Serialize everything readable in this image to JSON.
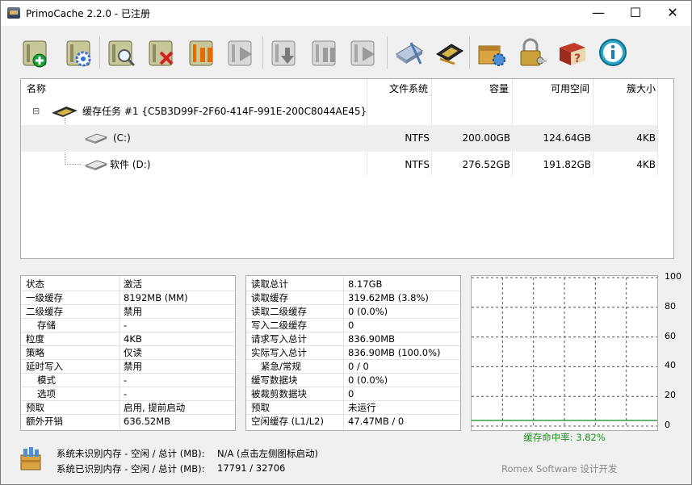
{
  "window": {
    "title": "PrimoCache 2.2.0 - 已注册",
    "controls": {
      "minimize": "—",
      "maximize": "☐",
      "close": "✕"
    }
  },
  "toolbar": {
    "buttons": [
      {
        "name": "new-cache-task",
        "icon": "disk-plus-icon"
      },
      {
        "name": "cache-properties",
        "icon": "disk-gear-icon"
      },
      {
        "name": "cache-statistics",
        "icon": "disk-magnifier-icon"
      },
      {
        "name": "delete-cache-task",
        "icon": "disk-x-icon"
      },
      {
        "name": "pause-cache",
        "icon": "disk-pause-icon"
      },
      {
        "name": "resume-cache",
        "icon": "disk-play-icon"
      },
      {
        "name": "flush-cache",
        "icon": "disk-download-icon"
      },
      {
        "name": "pause-all",
        "icon": "disk-pause-all-icon"
      },
      {
        "name": "resume-all",
        "icon": "disk-play-all-icon"
      },
      {
        "name": "l2-storage",
        "icon": "ssd-tools-icon"
      },
      {
        "name": "system-memory",
        "icon": "memory-chip-icon"
      },
      {
        "name": "options",
        "icon": "toolbox-gear-icon"
      },
      {
        "name": "license",
        "icon": "lock-key-icon"
      },
      {
        "name": "help",
        "icon": "book-help-icon"
      },
      {
        "name": "about",
        "icon": "info-icon"
      }
    ]
  },
  "tree": {
    "headers": {
      "name": "名称",
      "fs": "文件系统",
      "capacity": "容量",
      "free": "可用空间",
      "cluster": "簇大小"
    },
    "task": {
      "label": "缓存任务 #1 {C5B3D99F-2F60-414F-991E-200C8044AE45}",
      "expander": "⊟"
    },
    "volumes": [
      {
        "name": "(C:)",
        "fs": "NTFS",
        "capacity": "200.00GB",
        "free": "124.64GB",
        "cluster": "4KB"
      },
      {
        "name": "软件 (D:)",
        "fs": "NTFS",
        "capacity": "276.52GB",
        "free": "191.82GB",
        "cluster": "4KB"
      }
    ]
  },
  "status_panel": [
    {
      "key": "状态",
      "value": "激活"
    },
    {
      "key": "一级缓存",
      "value": "8192MB (MM)"
    },
    {
      "key": "二级缓存",
      "value": "禁用"
    },
    {
      "key": "存储",
      "value": "-"
    },
    {
      "key": "粒度",
      "value": "4KB"
    },
    {
      "key": "策略",
      "value": "仅读"
    },
    {
      "key": "延时写入",
      "value": "禁用"
    },
    {
      "key": "模式",
      "value": "-"
    },
    {
      "key": "选项",
      "value": "-"
    },
    {
      "key": "预取",
      "value": "启用, 提前启动"
    },
    {
      "key": "额外开销",
      "value": "636.52MB"
    }
  ],
  "stats_panel": [
    {
      "key": "读取总计",
      "value": "8.17GB"
    },
    {
      "key": "读取缓存",
      "value": "319.62MB (3.8%)"
    },
    {
      "key": "读取二级缓存",
      "value": "0 (0.0%)"
    },
    {
      "key": "写入二级缓存",
      "value": "0"
    },
    {
      "key": "请求写入总计",
      "value": "836.90MB"
    },
    {
      "key": "实际写入总计",
      "value": "836.90MB (100.0%)"
    },
    {
      "key": "紧急/常规",
      "value": "0 / 0"
    },
    {
      "key": "缓写数据块",
      "value": "0 (0.0%)"
    },
    {
      "key": "被裁剪数据块",
      "value": "0"
    },
    {
      "key": "预取",
      "value": "未运行"
    },
    {
      "key": "空闲缓存 (L1/L2)",
      "value": "47.47MB / 0"
    }
  ],
  "chart_data": {
    "type": "line",
    "ylim": [
      0,
      100
    ],
    "yticks": [
      "100",
      "80",
      "60",
      "40",
      "20",
      "0"
    ],
    "series": [
      {
        "values": [
          3.82,
          3.82,
          3.82,
          3.82,
          3.82,
          3.82,
          3.82,
          3.82,
          3.82,
          3.82
        ]
      }
    ],
    "color": "#2ea043",
    "caption": "缓存命中率: 3.82%"
  },
  "bottom": {
    "unrecognized_label": "系统未识别内存 - 空闲 / 总计 (MB):",
    "unrecognized_value": "N/A (点击左侧图标启动)",
    "recognized_label": "系统已识别内存 - 空闲 / 总计 (MB):",
    "recognized_value": "17791 / 32706",
    "footer": "Romex Software 设计开发"
  }
}
